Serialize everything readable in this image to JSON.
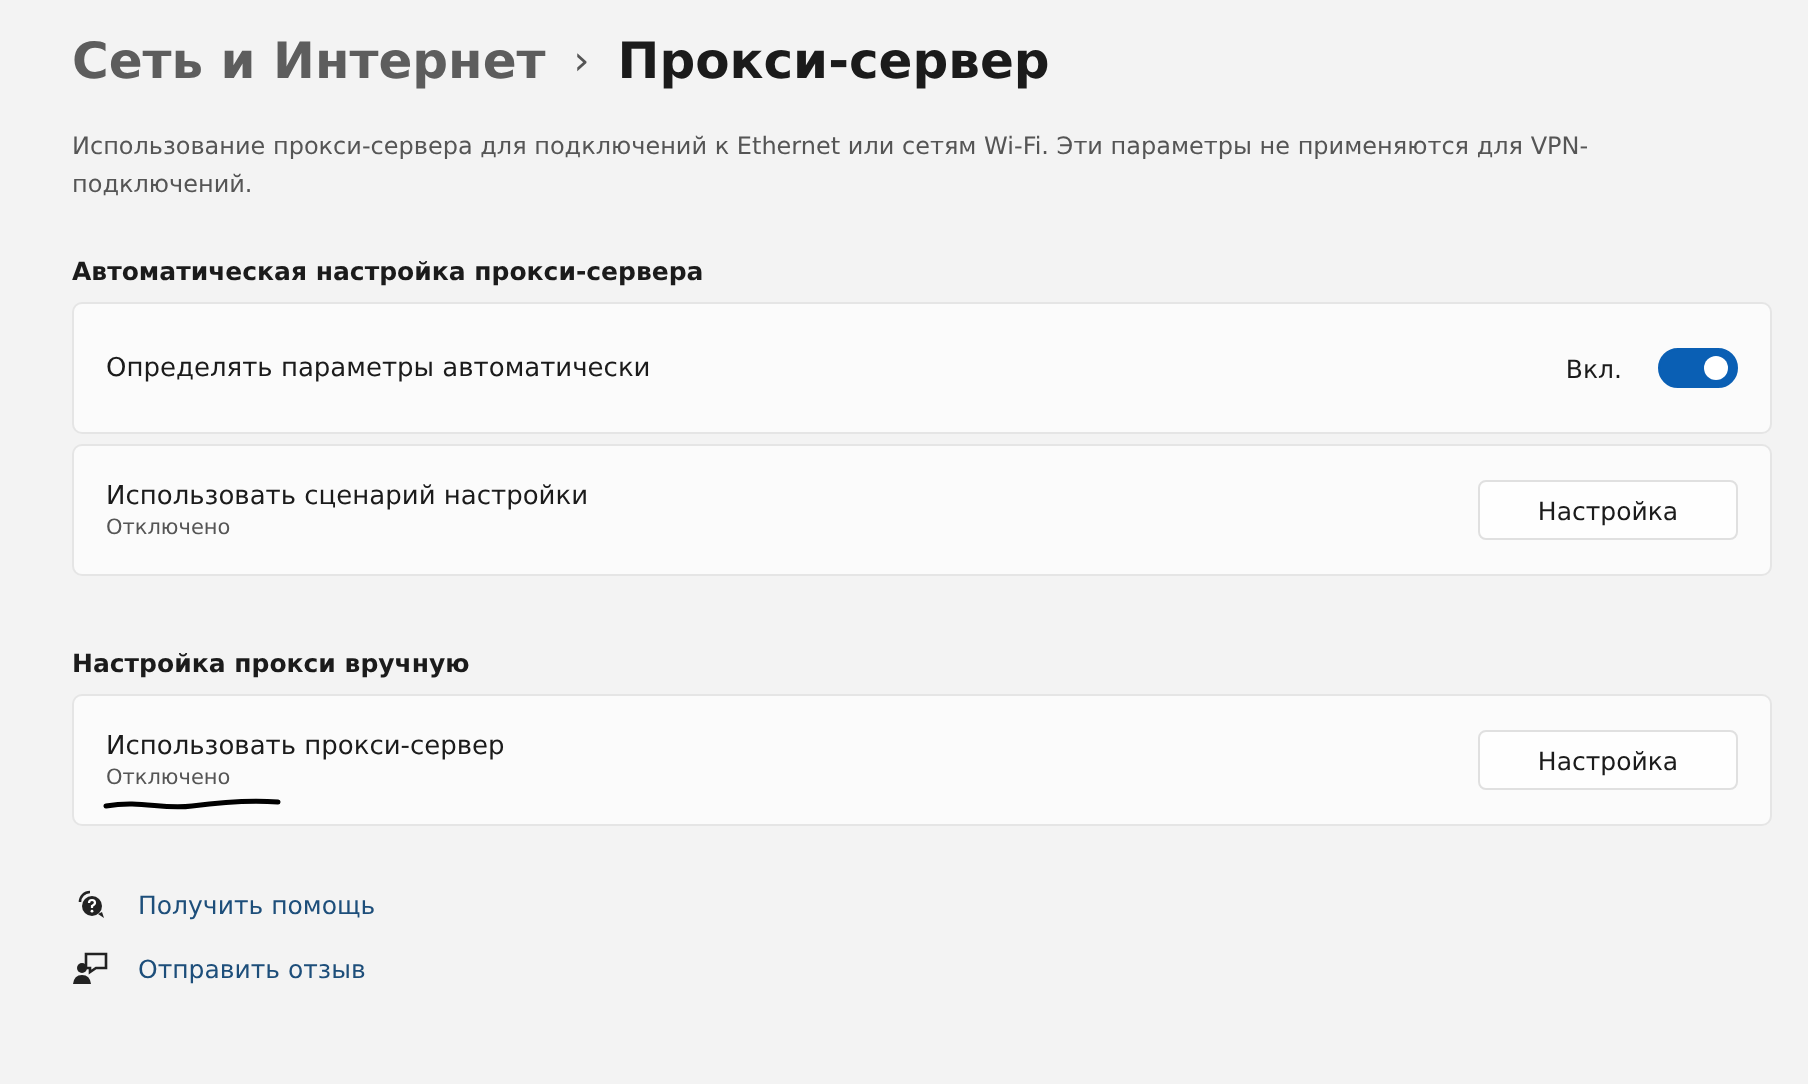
{
  "breadcrumb": {
    "parent": "Сеть и Интернет",
    "separator": "›",
    "current": "Прокси-сервер"
  },
  "description": "Использование прокси-сервера для подключений к Ethernet или сетям Wi-Fi. Эти параметры не применяются для VPN-подключений.",
  "sections": [
    {
      "heading": "Автоматическая настройка прокси-сервера",
      "items": [
        {
          "kind": "toggle",
          "title": "Определять параметры автоматически",
          "state_label": "Вкл.",
          "on": true
        },
        {
          "kind": "button",
          "title": "Использовать сценарий настройки",
          "subtitle": "Отключено",
          "button": "Настройка"
        }
      ]
    },
    {
      "heading": "Настройка прокси вручную",
      "items": [
        {
          "kind": "button",
          "title": "Использовать прокси-сервер",
          "subtitle": "Отключено",
          "button": "Настройка",
          "scribbled": true
        }
      ]
    }
  ],
  "links": [
    {
      "kind": "help",
      "label": "Получить помощь"
    },
    {
      "kind": "feedback",
      "label": "Отправить отзыв"
    }
  ]
}
